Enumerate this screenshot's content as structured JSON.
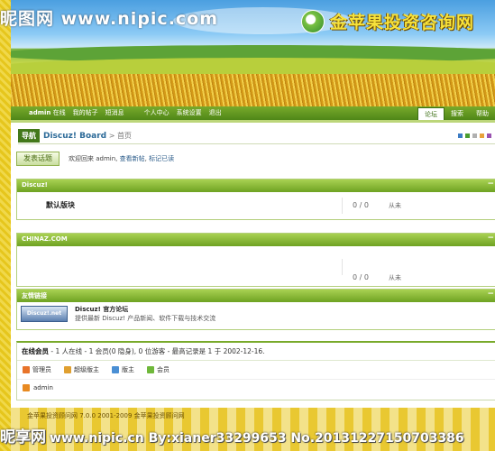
{
  "banner": {
    "watermark_top": "昵图网 www.nipic.com",
    "logo_text": "金苹果投资咨询网"
  },
  "topnav": {
    "user": "admin",
    "status": "在线",
    "links": [
      "我的帖子",
      "短消息",
      "个人中心",
      "系统设置",
      "退出"
    ],
    "tabs": [
      "论坛",
      "搜索",
      "帮助"
    ],
    "active_tab": "论坛"
  },
  "breadcrumb": {
    "tag": "导航",
    "board": "Discuz! Board",
    "separator": ">",
    "home": "首页"
  },
  "theme_colors": [
    "#3c7cc4",
    "#4a9d2e",
    "#b0b0b0",
    "#e8a23a",
    "#9a53b0"
  ],
  "userbar": {
    "post_button": "发表话题",
    "welcome_prefix": "欢迎回来",
    "username": "admin",
    "link_new": "查看新帖",
    "link_mark": "标记已读"
  },
  "sections": [
    {
      "title": "Discuz!",
      "forum": "默认版块",
      "count": "0 / 0",
      "last": "从未"
    },
    {
      "title": "CHINAZ.COM",
      "forum": "",
      "count": "0 / 0",
      "last": "从未"
    }
  ],
  "links_section": {
    "title": "友情链接",
    "logo_text": "Discuz!.net",
    "site_title": "Discuz! 官方论坛",
    "site_desc": "提供最新 Discuz! 产品新闻、软件下载与技术交流"
  },
  "online": {
    "title": "在线会员",
    "summary": "- 1 人在线 - 1 会员(0 隐身), 0 位游客 - 最高记录是 1 于 2002-12-16.",
    "legend": [
      {
        "label": "管理员",
        "color": "#e8742a"
      },
      {
        "label": "超级版主",
        "color": "#e0a030"
      },
      {
        "label": "版主",
        "color": "#4a8fd4"
      },
      {
        "label": "会员",
        "color": "#6fb83a"
      }
    ],
    "users": [
      "admin"
    ]
  },
  "footer": {
    "text": "金苹果投资顾问网 7.0.0  2001-2009 金苹果投资顾问网",
    "watermark_bottom_big": "昵享网",
    "watermark_bottom": "www.nipic.cn By:xianer33299653  No.20131227150703386"
  }
}
